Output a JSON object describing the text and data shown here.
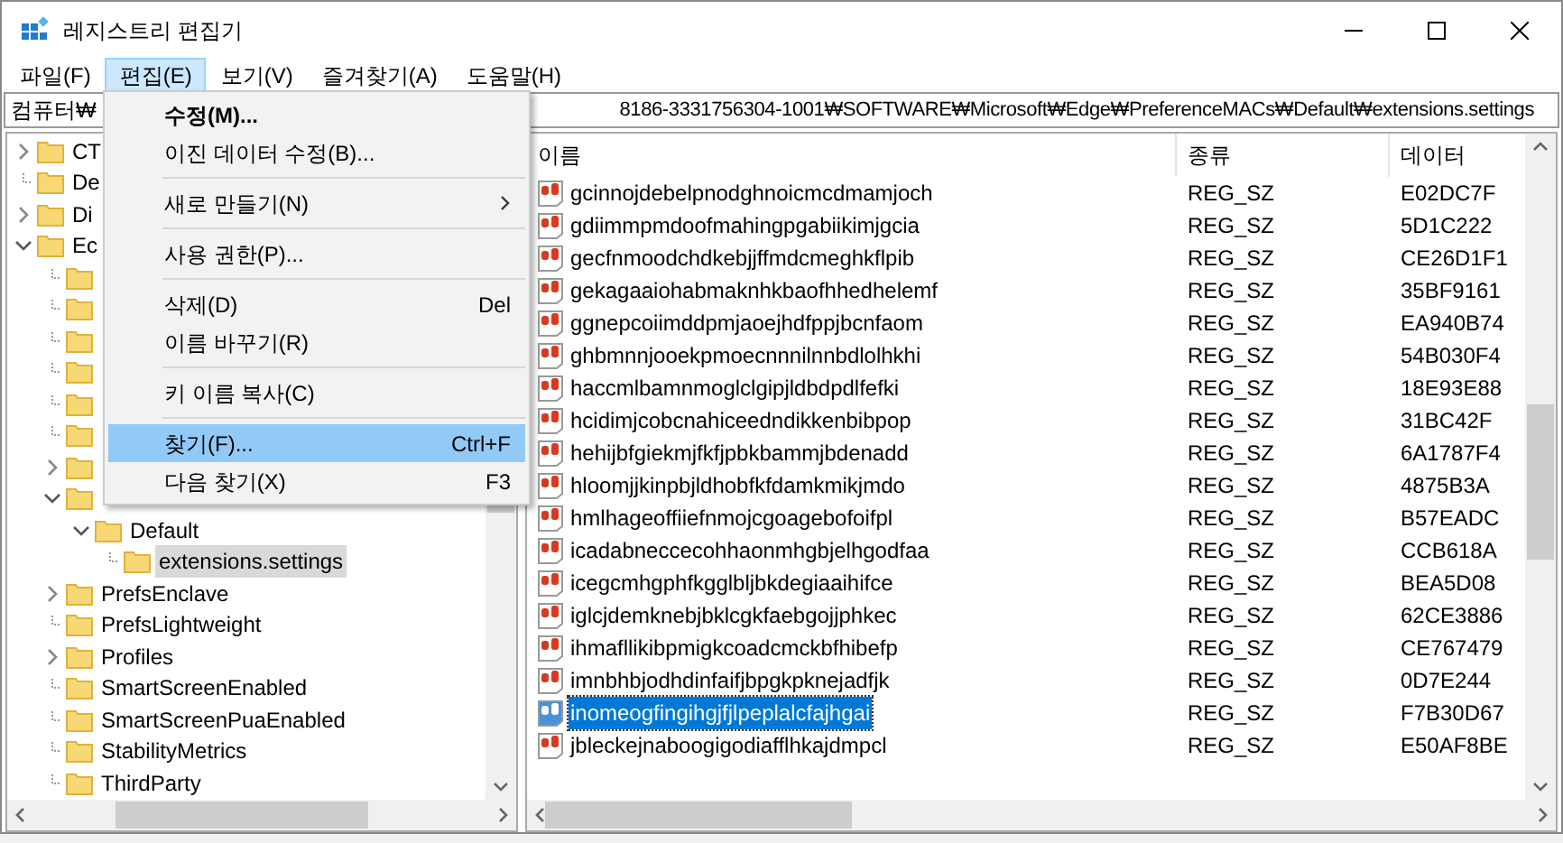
{
  "window": {
    "title": "레지스트리 편집기"
  },
  "menu_bar": [
    {
      "label": "파일(F)",
      "selected": false
    },
    {
      "label": "편집(E)",
      "selected": true
    },
    {
      "label": "보기(V)",
      "selected": false
    },
    {
      "label": "즐겨찾기(A)",
      "selected": false
    },
    {
      "label": "도움말(H)",
      "selected": false
    }
  ],
  "address": {
    "start": "컴퓨터₩",
    "end": "8186-3331756304-1001₩SOFTWARE₩Microsoft₩Edge₩PreferenceMACs₩Default₩extensions.settings"
  },
  "tree": [
    {
      "label": "CT",
      "expandable": true,
      "expanded": false
    },
    {
      "label": "De",
      "expandable": false
    },
    {
      "label": "Di",
      "expandable": true,
      "expanded": false
    },
    {
      "label": "Ec",
      "expandable": true,
      "expanded": true,
      "children": [
        {
          "expandable": false
        },
        {
          "expandable": false
        },
        {
          "expandable": false
        },
        {
          "expandable": false
        },
        {
          "expandable": false
        },
        {
          "expandable": false
        },
        {
          "expandable": true,
          "expanded": false
        },
        {
          "expandable": true,
          "expanded": true,
          "children": [
            {
              "label": "Default",
              "expandable": true,
              "expanded": true,
              "children": [
                {
                  "label": "extensions.settings",
                  "expandable": false,
                  "selected": true
                }
              ]
            }
          ]
        },
        {
          "label": "PrefsEnclave",
          "expandable": true,
          "expanded": false
        },
        {
          "label": "PrefsLightweight",
          "expandable": false
        },
        {
          "label": "Profiles",
          "expandable": true,
          "expanded": false
        },
        {
          "label": "SmartScreenEnabled",
          "expandable": false
        },
        {
          "label": "SmartScreenPuaEnabled",
          "expandable": false
        },
        {
          "label": "StabilityMetrics",
          "expandable": false
        },
        {
          "label": "ThirdParty",
          "expandable": false
        }
      ]
    }
  ],
  "table": {
    "columns": [
      "이름",
      "종류",
      "데이터"
    ],
    "rows": [
      {
        "name": "gcinnojdebelpnodghnoicmcdmamjoch",
        "type": "REG_SZ",
        "data": "E02DC7F",
        "selected": false
      },
      {
        "name": "gdiimmpmdoofmahingpgabiikimjgcia",
        "type": "REG_SZ",
        "data": "5D1C222",
        "selected": false
      },
      {
        "name": "gecfnmoodchdkebjjffmdcmeghkflpib",
        "type": "REG_SZ",
        "data": "CE26D1F1",
        "selected": false
      },
      {
        "name": "gekagaaiohabmaknhkbaofhhedhelemf",
        "type": "REG_SZ",
        "data": "35BF9161",
        "selected": false
      },
      {
        "name": "ggnepcoiimddpmjaoejhdfppjbcnfaom",
        "type": "REG_SZ",
        "data": "EA940B74",
        "selected": false
      },
      {
        "name": "ghbmnnjooekpmoecnnnilnnbdlolhkhi",
        "type": "REG_SZ",
        "data": "54B030F4",
        "selected": false
      },
      {
        "name": "haccmlbamnmoglclgipjldbdpdlfefki",
        "type": "REG_SZ",
        "data": "18E93E88",
        "selected": false
      },
      {
        "name": "hcidimjcobcnahiceedndikkenbibpop",
        "type": "REG_SZ",
        "data": "31BC42F",
        "selected": false
      },
      {
        "name": "hehijbfgiekmjfkfjpbkbammjbdenadd",
        "type": "REG_SZ",
        "data": "6A1787F4",
        "selected": false
      },
      {
        "name": "hloomjjkinpbjldhobfkfdamkmikjmdo",
        "type": "REG_SZ",
        "data": "4875B3A",
        "selected": false
      },
      {
        "name": "hmlhageoffiiefnmojcgoagebofoifpl",
        "type": "REG_SZ",
        "data": "B57EADC",
        "selected": false
      },
      {
        "name": "icadabneccecohhaonmhgbjelhgodfaa",
        "type": "REG_SZ",
        "data": "CCB618A",
        "selected": false
      },
      {
        "name": "icegcmhgphfkgglbljbkdegiaaihifce",
        "type": "REG_SZ",
        "data": "BEA5D08",
        "selected": false
      },
      {
        "name": "iglcjdemknebjbklcgkfaebgojjphkec",
        "type": "REG_SZ",
        "data": "62CE3886",
        "selected": false
      },
      {
        "name": "ihmafllikibpmigkcoadcmckbfhibefp",
        "type": "REG_SZ",
        "data": "CE767479",
        "selected": false
      },
      {
        "name": "imnbhbjodhdinfaifjbpgkpknejadfjk",
        "type": "REG_SZ",
        "data": "0D7E244",
        "selected": false
      },
      {
        "name": "inomeogfingihgjfjlpeplalcfajhgai",
        "type": "REG_SZ",
        "data": "F7B30D67",
        "selected": true
      },
      {
        "name": "jbleckejnaboogigodiafflhkajdmpcl",
        "type": "REG_SZ",
        "data": "E50AF8BE",
        "selected": false
      }
    ]
  },
  "edit_menu": [
    {
      "kind": "item",
      "label": "수정(M)...",
      "bold": true,
      "selected": false
    },
    {
      "kind": "item",
      "label": "이진 데이터 수정(B)...",
      "selected": false
    },
    {
      "kind": "separator"
    },
    {
      "kind": "submenu",
      "label": "새로 만들기(N)",
      "selected": false
    },
    {
      "kind": "separator"
    },
    {
      "kind": "item",
      "label": "사용 권한(P)...",
      "selected": false
    },
    {
      "kind": "separator"
    },
    {
      "kind": "item",
      "label": "삭제(D)",
      "shortcut": "Del",
      "selected": false
    },
    {
      "kind": "item",
      "label": "이름 바꾸기(R)",
      "selected": false
    },
    {
      "kind": "separator"
    },
    {
      "kind": "item",
      "label": "키 이름 복사(C)",
      "selected": false
    },
    {
      "kind": "separator"
    },
    {
      "kind": "item",
      "label": "찾기(F)...",
      "shortcut": "Ctrl+F",
      "selected": true
    },
    {
      "kind": "item",
      "label": "다음 찾기(X)",
      "shortcut": "F3",
      "selected": false
    }
  ]
}
